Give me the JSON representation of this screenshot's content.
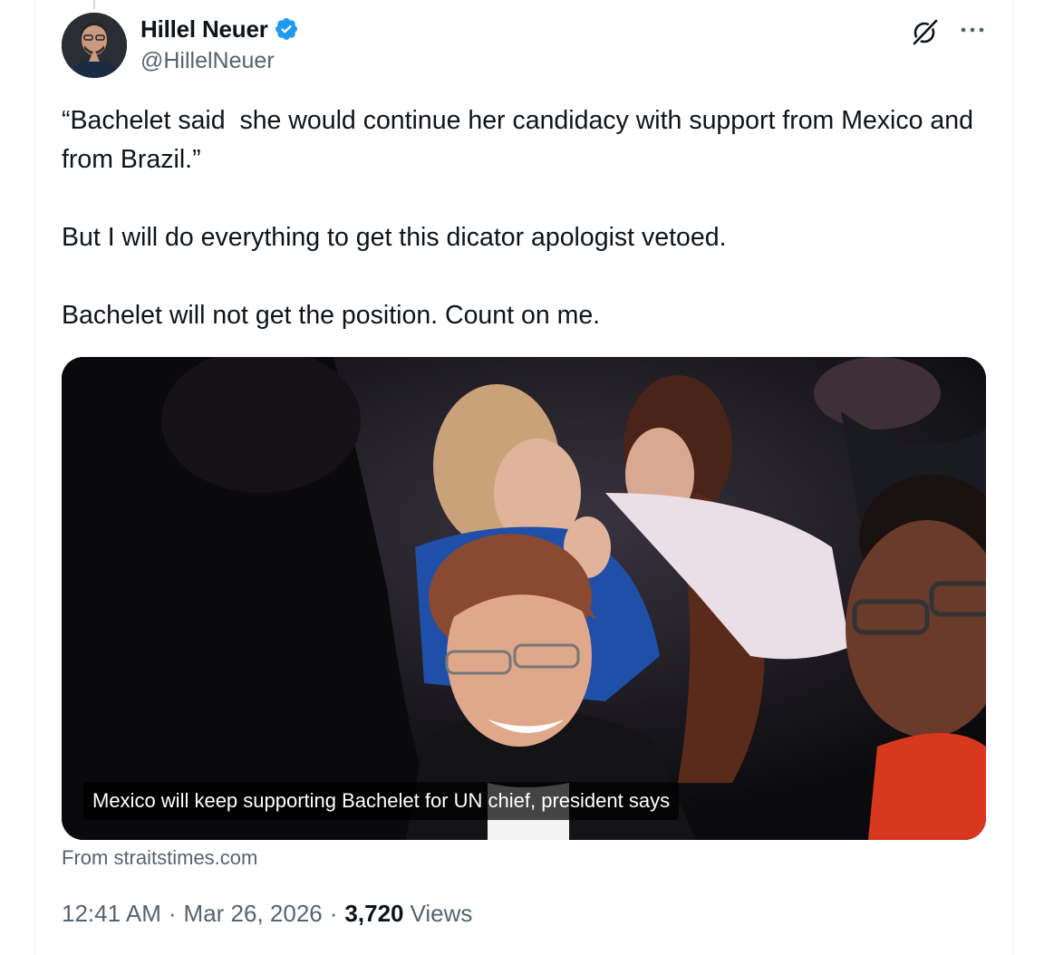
{
  "author": {
    "display_name": "Hillel Neuer",
    "handle": "@HillelNeuer",
    "verified": true
  },
  "header_icons": {
    "grok": "grok-icon",
    "more": "more-icon"
  },
  "tweet": {
    "paragraphs": [
      "“Bachelet said  she would continue her candidacy with support from Mexico and from Brazil.”",
      "But I will do everything to get this dicator apologist vetoed.",
      "Bachelet will not get the position. Count on me."
    ]
  },
  "link_card": {
    "headline": "Mexico will keep supporting Bachelet for UN chief, president says",
    "source": "From straitstimes.com"
  },
  "meta": {
    "time": "12:41 AM",
    "separator": "·",
    "date": "Mar 26, 2026",
    "views_count": "3,720",
    "views_label": "Views"
  },
  "colors": {
    "text_primary": "#0f1419",
    "text_secondary": "#536471",
    "verified_blue": "#1d9bf0",
    "border": "#eff3f4"
  }
}
